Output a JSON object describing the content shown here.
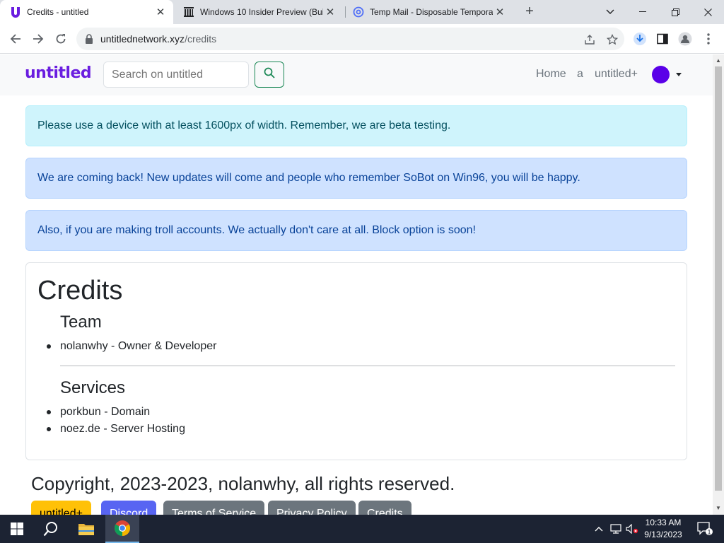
{
  "browser": {
    "tabs": [
      {
        "title": "Credits - untitled",
        "favicon": "untitled-u-logo",
        "active": true
      },
      {
        "title": "Windows 10 Insider Preview (Bui",
        "favicon": "archive-org-icon",
        "active": false
      },
      {
        "title": "Temp Mail - Disposable Tempora",
        "favicon": "at-sign-icon",
        "active": false
      }
    ],
    "url_host": "untitlednetwork.xyz",
    "url_path": "/credits"
  },
  "site": {
    "brand": "untitled",
    "search_placeholder": "Search on untitled",
    "nav": {
      "home": "Home",
      "a": "a",
      "plus": "untitled+"
    },
    "colors": {
      "brand": "#6a1de0",
      "avatar": "#5a00e8",
      "search_outline": "#198754"
    }
  },
  "alerts": [
    {
      "text": "Please use a device with at least 1600px of width. Remember, we are beta testing.",
      "variant": "info"
    },
    {
      "text": "We are coming back! New updates will come and people who remember SoBot on Win96, you will be happy.",
      "variant": "primary"
    },
    {
      "text": "Also, if you are making troll accounts. We actually don't care at all. Block option is soon!",
      "variant": "primary"
    }
  ],
  "credits": {
    "title": "Credits",
    "team_heading": "Team",
    "team": [
      "nolanwhy - Owner & Developer"
    ],
    "services_heading": "Services",
    "services": [
      "porkbun - Domain",
      "noez.de - Server Hosting"
    ]
  },
  "footer": {
    "copyright": "Copyright, 2023-2023, nolanwhy, all rights reserved.",
    "buttons": [
      {
        "label": "untitled+",
        "color": "#ffc107",
        "text_color": "#000000"
      },
      {
        "label": "Discord",
        "color": "#5865f2",
        "text_color": "#ffffff"
      },
      {
        "label": "Terms of Service",
        "color": "#6c757d",
        "text_color": "#ffffff"
      },
      {
        "label": "Privacy Policy",
        "color": "#6c757d",
        "text_color": "#ffffff"
      },
      {
        "label": "Credits",
        "color": "#6c757d",
        "text_color": "#ffffff"
      }
    ]
  },
  "taskbar": {
    "time": "10:33 AM",
    "date": "9/13/2023",
    "notification_count": "1"
  }
}
